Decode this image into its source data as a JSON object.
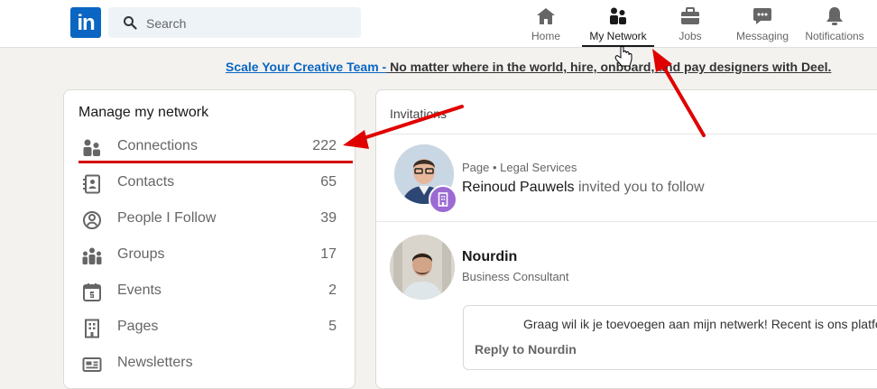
{
  "header": {
    "logo": "in",
    "search_placeholder": "Search",
    "nav": [
      {
        "label": "Home",
        "icon": "home-icon"
      },
      {
        "label": "My Network",
        "icon": "network-icon"
      },
      {
        "label": "Jobs",
        "icon": "briefcase-icon"
      },
      {
        "label": "Messaging",
        "icon": "messaging-icon"
      },
      {
        "label": "Notifications",
        "icon": "bell-icon"
      }
    ],
    "active_nav": "My Network"
  },
  "promo": {
    "link": "Scale Your Creative Team -",
    "text": " No matter where in the world, hire, onboard, and pay designers with Deel."
  },
  "network": {
    "title": "Manage my network",
    "items": [
      {
        "label": "Connections",
        "count": "222",
        "icon": "connections-icon"
      },
      {
        "label": "Contacts",
        "count": "65",
        "icon": "contacts-icon"
      },
      {
        "label": "People I Follow",
        "count": "39",
        "icon": "people-follow-icon"
      },
      {
        "label": "Groups",
        "count": "17",
        "icon": "groups-icon"
      },
      {
        "label": "Events",
        "count": "2",
        "icon": "events-icon"
      },
      {
        "label": "Pages",
        "count": "5",
        "icon": "pages-icon"
      },
      {
        "label": "Newsletters",
        "count": "",
        "icon": "newsletters-icon"
      }
    ]
  },
  "invitations": {
    "title": "Invitations",
    "items": [
      {
        "meta": "Page • Legal Services",
        "name": "Reinoud Pauwels",
        "action": " invited you to follow"
      },
      {
        "name": "Nourdin",
        "headline": "Business Consultant",
        "message": "Graag wil ik je toevoegen aan mijn netwerk! Recent is ons platfo",
        "reply": "Reply to Nourdin"
      }
    ]
  },
  "colors": {
    "brand": "#0a66c2",
    "annotation": "#d40000",
    "page_badge": "#9b6ad3"
  }
}
